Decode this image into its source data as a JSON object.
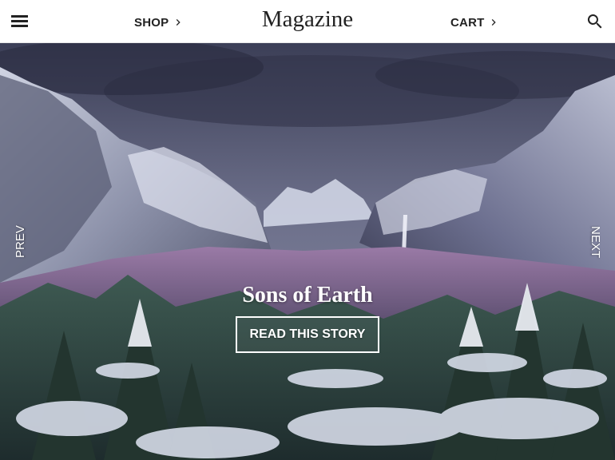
{
  "header": {
    "menu_icon": "menu-icon",
    "shop_label": "SHOP",
    "brand": "Magazine",
    "cart_label": "CART",
    "search_icon": "search-icon",
    "chevron_icon": "chevron-right-icon"
  },
  "hero": {
    "prev_label": "PREV",
    "next_label": "NEXT",
    "title": "Sons of Earth",
    "cta_label": "READ THIS STORY"
  },
  "colors": {
    "header_bg": "#ffffff",
    "text_dark": "#222222",
    "hero_text": "#ffffff"
  }
}
